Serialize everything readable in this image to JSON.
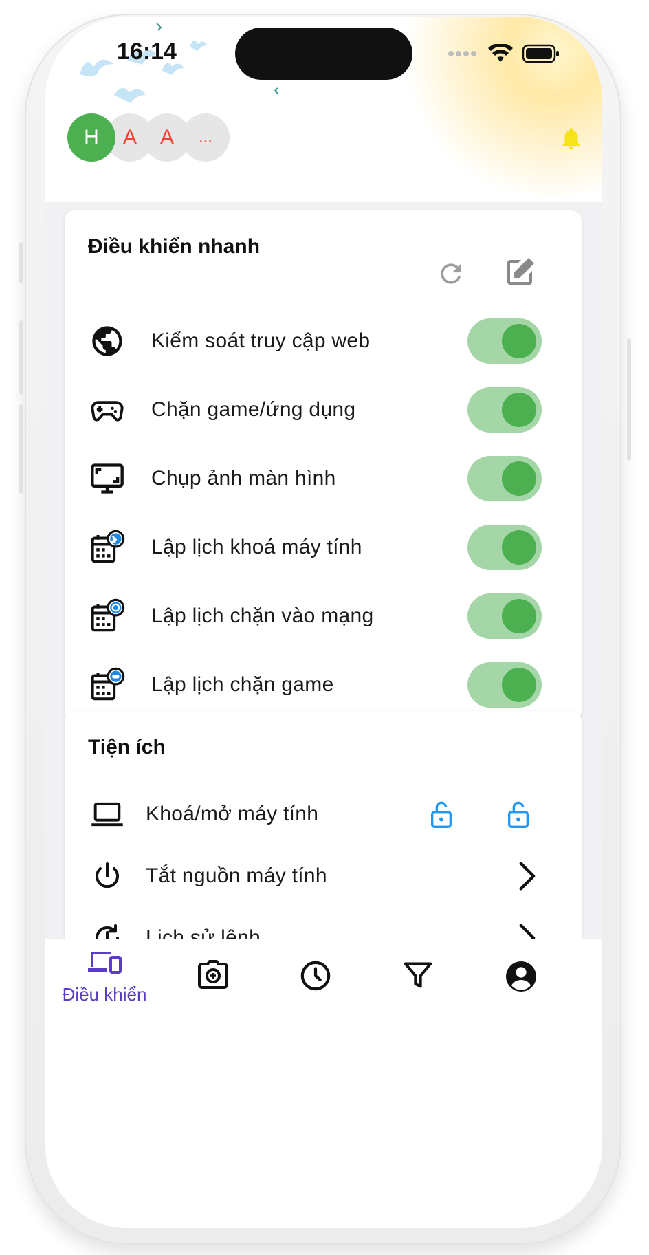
{
  "status_bar": {
    "time": "16:14",
    "icons": [
      "signal-dots-icon",
      "wifi-icon",
      "battery-icon"
    ]
  },
  "header": {
    "avatars": [
      "H",
      "A",
      "A",
      "..."
    ],
    "notification_icon": "bell-icon",
    "colors": {
      "avatar_active": "#4caf50",
      "avatar_letter": "#f44336",
      "bell": "#f7e31b"
    }
  },
  "quick_controls": {
    "title": "Điều khiển nhanh",
    "actions": [
      "refresh-icon",
      "edit-icon"
    ],
    "items": [
      {
        "label": "Kiểm soát truy cập web",
        "icon": "globe-icon",
        "enabled": true
      },
      {
        "label": "Chặn game/ứng dụng",
        "icon": "gamepad-icon",
        "enabled": true
      },
      {
        "label": "Chụp ảnh màn hình",
        "icon": "screenshot-monitor-icon",
        "enabled": true
      },
      {
        "label": "Lập lịch khoá máy tính",
        "icon": "calendar-lock-icon",
        "enabled": true
      },
      {
        "label": "Lập lịch chặn vào mạng",
        "icon": "calendar-web-icon",
        "enabled": true
      },
      {
        "label": "Lập lịch chặn game",
        "icon": "calendar-game-icon",
        "enabled": true
      }
    ],
    "colors": {
      "toggle_track": "#a5d6a7",
      "toggle_knob": "#4caf50"
    }
  },
  "utilities": {
    "title": "Tiện ích",
    "items": [
      {
        "label": "Khoá/mở máy tính",
        "icon": "laptop-icon",
        "actions": [
          "lock-open-icon",
          "lock-open-icon"
        ]
      },
      {
        "label": "Tắt nguồn máy tính",
        "icon": "power-icon",
        "action": "chevron-right-icon"
      },
      {
        "label": "Lịch sử lệnh",
        "icon": "history-icon",
        "action": "chevron-right-icon"
      }
    ],
    "colors": {
      "lock": "#2196f3"
    }
  },
  "bottom_nav": {
    "items": [
      {
        "label": "Điều khiển",
        "icon": "devices-icon",
        "active": true
      },
      {
        "label": "",
        "icon": "camera-icon",
        "active": false
      },
      {
        "label": "",
        "icon": "clock-icon",
        "active": false
      },
      {
        "label": "",
        "icon": "filter-icon",
        "active": false
      },
      {
        "label": "",
        "icon": "account-icon",
        "active": false
      }
    ],
    "colors": {
      "active": "#5b3cc4",
      "inactive": "#111111"
    }
  }
}
